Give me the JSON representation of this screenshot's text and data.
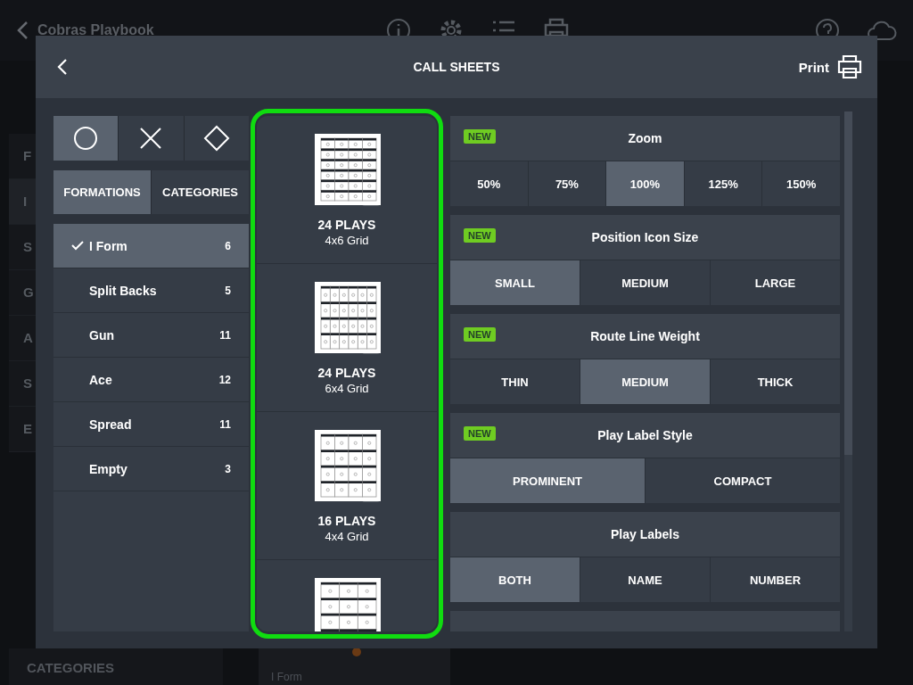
{
  "app": {
    "title": "Cobras Playbook",
    "sidebar_items": [
      {
        "label": "F",
        "selected": false
      },
      {
        "label": "I",
        "selected": true
      },
      {
        "label": "S",
        "selected": false
      },
      {
        "label": "G",
        "selected": false
      },
      {
        "label": "A",
        "selected": false
      },
      {
        "label": "S",
        "selected": false
      },
      {
        "label": "E",
        "selected": false
      }
    ],
    "sidebar_footer": "CATEGORIES",
    "card": {
      "formation": "I Form"
    }
  },
  "dialog": {
    "title": "CALL SHEETS",
    "print_label": "Print",
    "shape_tabs": [
      {
        "kind": "circle",
        "selected": true
      },
      {
        "kind": "cross",
        "selected": false
      },
      {
        "kind": "diamond",
        "selected": false
      }
    ],
    "view_tabs": [
      {
        "label": "FORMATIONS",
        "selected": true
      },
      {
        "label": "CATEGORIES",
        "selected": false
      }
    ],
    "formations": [
      {
        "name": "I Form",
        "count": "6",
        "checked": true
      },
      {
        "name": "Split Backs",
        "count": "5",
        "checked": false
      },
      {
        "name": "Gun",
        "count": "11",
        "checked": false
      },
      {
        "name": "Ace",
        "count": "12",
        "checked": false
      },
      {
        "name": "Spread",
        "count": "11",
        "checked": false
      },
      {
        "name": "Empty",
        "count": "3",
        "checked": false
      }
    ],
    "layouts": [
      {
        "kind": "grid-4x6",
        "title": "24 PLAYS",
        "subtitle": "4x6 Grid"
      },
      {
        "kind": "grid-6x4",
        "title": "24 PLAYS",
        "subtitle": "6x4 Grid"
      },
      {
        "kind": "grid-4x4",
        "title": "16 PLAYS",
        "subtitle": "4x4 Grid"
      },
      {
        "kind": "grid-3x4"
      }
    ],
    "settings": [
      {
        "title": "Zoom",
        "badge": "NEW",
        "options": [
          {
            "label": "50%",
            "selected": false
          },
          {
            "label": "75%",
            "selected": false
          },
          {
            "label": "100%",
            "selected": true
          },
          {
            "label": "125%",
            "selected": false
          },
          {
            "label": "150%",
            "selected": false
          }
        ]
      },
      {
        "title": "Position Icon Size",
        "badge": "NEW",
        "options": [
          {
            "label": "SMALL",
            "selected": true
          },
          {
            "label": "MEDIUM",
            "selected": false
          },
          {
            "label": "LARGE",
            "selected": false
          }
        ]
      },
      {
        "title": "Route Line Weight",
        "badge": "NEW",
        "options": [
          {
            "label": "THIN",
            "selected": false
          },
          {
            "label": "MEDIUM",
            "selected": true
          },
          {
            "label": "THICK",
            "selected": false
          }
        ]
      },
      {
        "title": "Play Label Style",
        "badge": "NEW",
        "options": [
          {
            "label": "PROMINENT",
            "selected": true
          },
          {
            "label": "COMPACT",
            "selected": false
          }
        ]
      },
      {
        "title": "Play Labels",
        "options": [
          {
            "label": "BOTH",
            "selected": true
          },
          {
            "label": "NAME",
            "selected": false
          },
          {
            "label": "NUMBER",
            "selected": false
          }
        ]
      }
    ]
  }
}
